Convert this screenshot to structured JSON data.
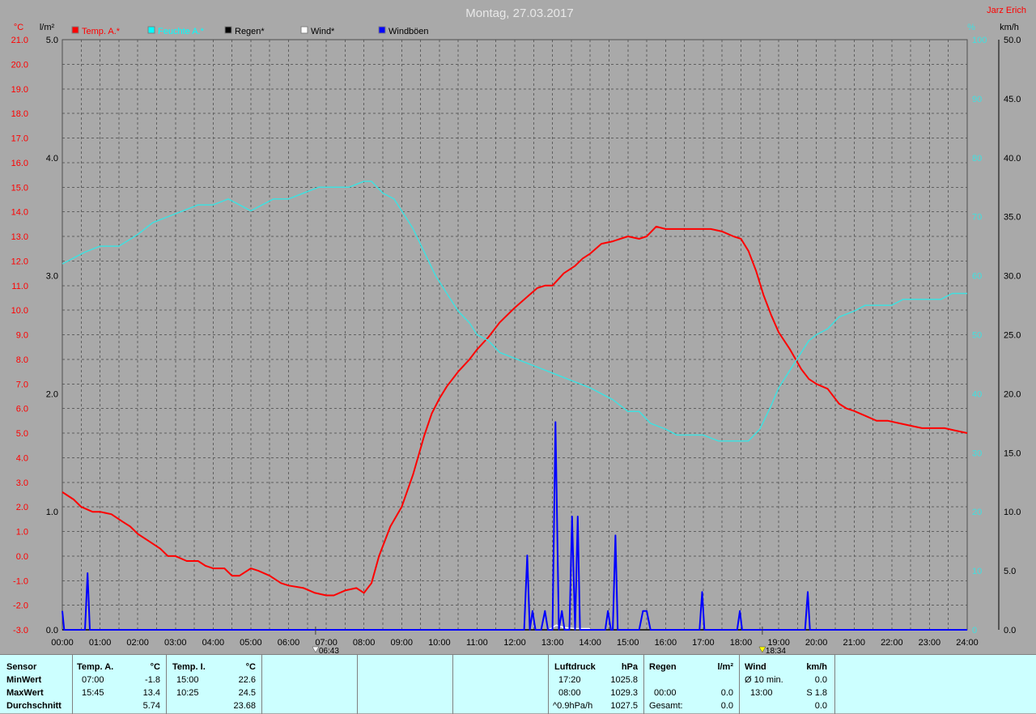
{
  "title": "Montag, 27.03.2017",
  "station": "Jarz Erich",
  "left_axes": {
    "temp_unit": "°C",
    "rain_unit": "l/m²"
  },
  "right_axes": {
    "hum_unit": "%",
    "wind_unit": "km/h"
  },
  "colors": {
    "temp": "#ff0000",
    "humidity": "#40e0e0",
    "rain": "#000000",
    "wind": "#ffffff",
    "gust": "#0000ff",
    "grid": "#606060",
    "bg": "#a9a9a9",
    "panel": "#ccffff"
  },
  "legend": [
    {
      "label": "Temp. A.*",
      "color": "#ff0000"
    },
    {
      "label": "Feuchte A.*",
      "color": "#00ffff"
    },
    {
      "label": "Regen*",
      "color": "#000000"
    },
    {
      "label": "Wind*",
      "color": "#ffffff"
    },
    {
      "label": "Windböen",
      "color": "#0000ff"
    }
  ],
  "sun": {
    "sunrise": "06:43",
    "sunset": "18:34"
  },
  "chart_data": {
    "type": "line",
    "title": "Montag, 27.03.2017",
    "x": [
      "00:00",
      "01:00",
      "02:00",
      "03:00",
      "04:00",
      "05:00",
      "06:00",
      "07:00",
      "08:00",
      "09:00",
      "10:00",
      "11:00",
      "12:00",
      "13:00",
      "14:00",
      "15:00",
      "16:00",
      "17:00",
      "18:00",
      "19:00",
      "20:00",
      "21:00",
      "22:00",
      "23:00",
      "24:00"
    ],
    "axes": {
      "temp": {
        "unit": "°C",
        "ylim": [
          -3.0,
          21.0
        ],
        "ticks": [
          "21.0",
          "20.0",
          "19.0",
          "18.0",
          "17.0",
          "16.0",
          "15.0",
          "14.0",
          "13.0",
          "12.0",
          "11.0",
          "10.0",
          "9.0",
          "8.0",
          "7.0",
          "6.0",
          "5.0",
          "4.0",
          "3.0",
          "2.0",
          "1.0",
          "0.0",
          "-1.0",
          "-2.0",
          "-3.0"
        ]
      },
      "rain": {
        "unit": "l/m²",
        "ylim": [
          0.0,
          5.0
        ],
        "ticks": [
          "5.0",
          "4.0",
          "3.0",
          "2.0",
          "1.0",
          "0.0"
        ]
      },
      "humidity": {
        "unit": "%",
        "ylim": [
          0,
          100
        ],
        "ticks": [
          "100",
          "90",
          "80",
          "70",
          "60",
          "50",
          "40",
          "30",
          "20",
          "10",
          "0"
        ]
      },
      "wind": {
        "unit": "km/h",
        "ylim": [
          0.0,
          50.0
        ],
        "ticks": [
          "50.0",
          "45.0",
          "40.0",
          "35.0",
          "30.0",
          "25.0",
          "20.0",
          "15.0",
          "10.0",
          "5.0",
          "0.0"
        ]
      }
    },
    "grid": true,
    "legend_position": "top",
    "series": [
      {
        "name": "Temp. A.*",
        "axis": "temp",
        "points": [
          [
            0,
            2.6
          ],
          [
            0.3,
            2.3
          ],
          [
            0.5,
            2.0
          ],
          [
            0.8,
            1.8
          ],
          [
            1.0,
            1.8
          ],
          [
            1.3,
            1.7
          ],
          [
            1.6,
            1.4
          ],
          [
            1.8,
            1.2
          ],
          [
            2.0,
            0.9
          ],
          [
            2.3,
            0.6
          ],
          [
            2.6,
            0.3
          ],
          [
            2.8,
            0.0
          ],
          [
            3.0,
            0.0
          ],
          [
            3.3,
            -0.2
          ],
          [
            3.6,
            -0.2
          ],
          [
            3.8,
            -0.4
          ],
          [
            4.0,
            -0.5
          ],
          [
            4.3,
            -0.5
          ],
          [
            4.5,
            -0.8
          ],
          [
            4.7,
            -0.8
          ],
          [
            5.0,
            -0.5
          ],
          [
            5.2,
            -0.6
          ],
          [
            5.5,
            -0.8
          ],
          [
            5.8,
            -1.1
          ],
          [
            6.0,
            -1.2
          ],
          [
            6.4,
            -1.3
          ],
          [
            6.7,
            -1.5
          ],
          [
            7.0,
            -1.6
          ],
          [
            7.2,
            -1.6
          ],
          [
            7.5,
            -1.4
          ],
          [
            7.8,
            -1.3
          ],
          [
            8.0,
            -1.5
          ],
          [
            8.2,
            -1.1
          ],
          [
            8.4,
            0.0
          ],
          [
            8.7,
            1.2
          ],
          [
            9.0,
            2.0
          ],
          [
            9.3,
            3.3
          ],
          [
            9.6,
            4.9
          ],
          [
            9.8,
            5.8
          ],
          [
            10.0,
            6.4
          ],
          [
            10.2,
            6.9
          ],
          [
            10.5,
            7.5
          ],
          [
            10.8,
            8.0
          ],
          [
            11.0,
            8.4
          ],
          [
            11.3,
            8.9
          ],
          [
            11.6,
            9.5
          ],
          [
            12.0,
            10.1
          ],
          [
            12.3,
            10.5
          ],
          [
            12.6,
            10.9
          ],
          [
            12.8,
            11.0
          ],
          [
            13.0,
            11.0
          ],
          [
            13.3,
            11.5
          ],
          [
            13.6,
            11.8
          ],
          [
            13.8,
            12.1
          ],
          [
            14.0,
            12.3
          ],
          [
            14.3,
            12.7
          ],
          [
            14.6,
            12.8
          ],
          [
            14.8,
            12.9
          ],
          [
            15.0,
            13.0
          ],
          [
            15.3,
            12.9
          ],
          [
            15.5,
            13.0
          ],
          [
            15.75,
            13.4
          ],
          [
            16.0,
            13.3
          ],
          [
            16.3,
            13.3
          ],
          [
            16.6,
            13.3
          ],
          [
            16.9,
            13.3
          ],
          [
            17.2,
            13.3
          ],
          [
            17.5,
            13.2
          ],
          [
            17.8,
            13.0
          ],
          [
            18.0,
            12.9
          ],
          [
            18.2,
            12.4
          ],
          [
            18.4,
            11.6
          ],
          [
            18.6,
            10.6
          ],
          [
            18.8,
            9.8
          ],
          [
            19.0,
            9.1
          ],
          [
            19.3,
            8.4
          ],
          [
            19.6,
            7.6
          ],
          [
            19.8,
            7.2
          ],
          [
            20.0,
            7.0
          ],
          [
            20.3,
            6.8
          ],
          [
            20.6,
            6.2
          ],
          [
            20.8,
            6.0
          ],
          [
            21.0,
            5.9
          ],
          [
            21.3,
            5.7
          ],
          [
            21.6,
            5.5
          ],
          [
            21.9,
            5.5
          ],
          [
            22.2,
            5.4
          ],
          [
            22.5,
            5.3
          ],
          [
            22.8,
            5.2
          ],
          [
            23.1,
            5.2
          ],
          [
            23.4,
            5.2
          ],
          [
            23.7,
            5.1
          ],
          [
            24.0,
            5.0
          ]
        ]
      },
      {
        "name": "Feuchte A.*",
        "axis": "humidity",
        "points": [
          [
            0,
            62
          ],
          [
            0.3,
            63
          ],
          [
            0.6,
            64
          ],
          [
            1.0,
            65
          ],
          [
            1.5,
            65
          ],
          [
            2.0,
            67
          ],
          [
            2.4,
            69
          ],
          [
            2.8,
            70
          ],
          [
            3.2,
            71
          ],
          [
            3.6,
            72
          ],
          [
            4.0,
            72
          ],
          [
            4.4,
            73
          ],
          [
            4.7,
            72
          ],
          [
            5.0,
            71
          ],
          [
            5.3,
            72
          ],
          [
            5.6,
            73
          ],
          [
            6.0,
            73
          ],
          [
            6.4,
            74
          ],
          [
            6.8,
            75
          ],
          [
            7.2,
            75
          ],
          [
            7.6,
            75
          ],
          [
            8.0,
            76
          ],
          [
            8.2,
            76
          ],
          [
            8.5,
            74
          ],
          [
            8.8,
            73
          ],
          [
            9.0,
            71
          ],
          [
            9.3,
            68
          ],
          [
            9.6,
            64
          ],
          [
            9.9,
            60
          ],
          [
            10.2,
            57
          ],
          [
            10.5,
            54
          ],
          [
            10.8,
            52
          ],
          [
            11.0,
            50
          ],
          [
            11.3,
            49
          ],
          [
            11.6,
            47
          ],
          [
            12.0,
            46
          ],
          [
            12.4,
            45
          ],
          [
            12.8,
            44
          ],
          [
            13.2,
            43
          ],
          [
            13.6,
            42
          ],
          [
            14.0,
            41
          ],
          [
            14.3,
            40
          ],
          [
            14.6,
            39
          ],
          [
            15.0,
            37
          ],
          [
            15.3,
            37
          ],
          [
            15.6,
            35
          ],
          [
            16.0,
            34
          ],
          [
            16.3,
            33
          ],
          [
            16.6,
            33
          ],
          [
            17.0,
            33
          ],
          [
            17.4,
            32
          ],
          [
            17.8,
            32
          ],
          [
            18.2,
            32
          ],
          [
            18.5,
            34
          ],
          [
            18.8,
            38
          ],
          [
            19.0,
            41
          ],
          [
            19.3,
            44
          ],
          [
            19.6,
            47
          ],
          [
            19.8,
            49
          ],
          [
            20.0,
            50
          ],
          [
            20.3,
            51
          ],
          [
            20.6,
            53
          ],
          [
            21.0,
            54
          ],
          [
            21.3,
            55
          ],
          [
            21.6,
            55
          ],
          [
            22.0,
            55
          ],
          [
            22.3,
            56
          ],
          [
            22.6,
            56
          ],
          [
            23.0,
            56
          ],
          [
            23.3,
            56
          ],
          [
            23.6,
            57
          ],
          [
            24.0,
            57
          ]
        ]
      },
      {
        "name": "Regen*",
        "axis": "rain",
        "points": [
          [
            0,
            0.0
          ],
          [
            24,
            0.0
          ]
        ]
      },
      {
        "name": "Wind*",
        "axis": "wind",
        "points": [
          [
            12.9,
            0.0
          ],
          [
            13.1,
            0.4
          ],
          [
            13.3,
            0.2
          ],
          [
            13.6,
            0.1
          ],
          [
            14.0,
            0.1
          ]
        ]
      },
      {
        "name": "Windböen",
        "axis": "wind",
        "points": [
          [
            0.0,
            1.6
          ],
          [
            0.05,
            0.0
          ],
          [
            0.6,
            0.0
          ],
          [
            0.67,
            4.8
          ],
          [
            0.73,
            0.0
          ],
          [
            12.25,
            0.0
          ],
          [
            12.33,
            6.3
          ],
          [
            12.4,
            0.0
          ],
          [
            12.47,
            1.6
          ],
          [
            12.55,
            0.0
          ],
          [
            12.7,
            0.0
          ],
          [
            12.8,
            1.6
          ],
          [
            12.88,
            0.0
          ],
          [
            13.0,
            0.0
          ],
          [
            13.08,
            17.6
          ],
          [
            13.17,
            0.0
          ],
          [
            13.25,
            1.6
          ],
          [
            13.32,
            0.0
          ],
          [
            13.45,
            0.0
          ],
          [
            13.52,
            9.6
          ],
          [
            13.6,
            0.0
          ],
          [
            13.67,
            9.6
          ],
          [
            13.73,
            0.0
          ],
          [
            14.4,
            0.0
          ],
          [
            14.47,
            1.6
          ],
          [
            14.55,
            0.0
          ],
          [
            14.6,
            0.0
          ],
          [
            14.67,
            8.0
          ],
          [
            14.73,
            0.0
          ],
          [
            15.3,
            0.0
          ],
          [
            15.4,
            1.6
          ],
          [
            15.5,
            1.6
          ],
          [
            15.6,
            0.0
          ],
          [
            16.9,
            0.0
          ],
          [
            16.97,
            3.2
          ],
          [
            17.03,
            0.0
          ],
          [
            17.9,
            0.0
          ],
          [
            17.97,
            1.6
          ],
          [
            18.03,
            0.0
          ],
          [
            19.7,
            0.0
          ],
          [
            19.77,
            3.2
          ],
          [
            19.83,
            0.0
          ],
          [
            24.0,
            0.0
          ]
        ]
      }
    ]
  },
  "stats": {
    "sensor_label": "Sensor",
    "row_labels": [
      "MinWert",
      "MaxWert",
      "Durchschnitt"
    ],
    "temp_a": {
      "header": "Temp. A.",
      "unit": "°C",
      "min_time": "07:00",
      "min_val": "-1.8",
      "max_time": "15:45",
      "max_val": "13.4",
      "avg_val": "5.74"
    },
    "temp_i": {
      "header": "Temp. I.",
      "unit": "°C",
      "min_time": "15:00",
      "min_val": "22.6",
      "max_time": "10:25",
      "max_val": "24.5",
      "avg_val": "23.68"
    },
    "pressure": {
      "header": "Luftdruck",
      "unit": "hPa",
      "min_time": "17:20",
      "min_val": "1025.8",
      "max_time": "08:00",
      "max_val": "1029.3",
      "trend": "^0.9hPa/h",
      "avg_val": "1027.5"
    },
    "rain": {
      "header": "Regen",
      "unit": "l/m²",
      "time": "00:00",
      "val": "0.0",
      "total_label": "Gesamt:",
      "total_val": "0.0"
    },
    "wind": {
      "header": "Wind",
      "unit": "km/h",
      "avg_label": "Ø 10 min.",
      "avg_val": "0.0",
      "time": "13:00",
      "dir_val": "S 1.8",
      "extra_val": "0.0"
    }
  }
}
